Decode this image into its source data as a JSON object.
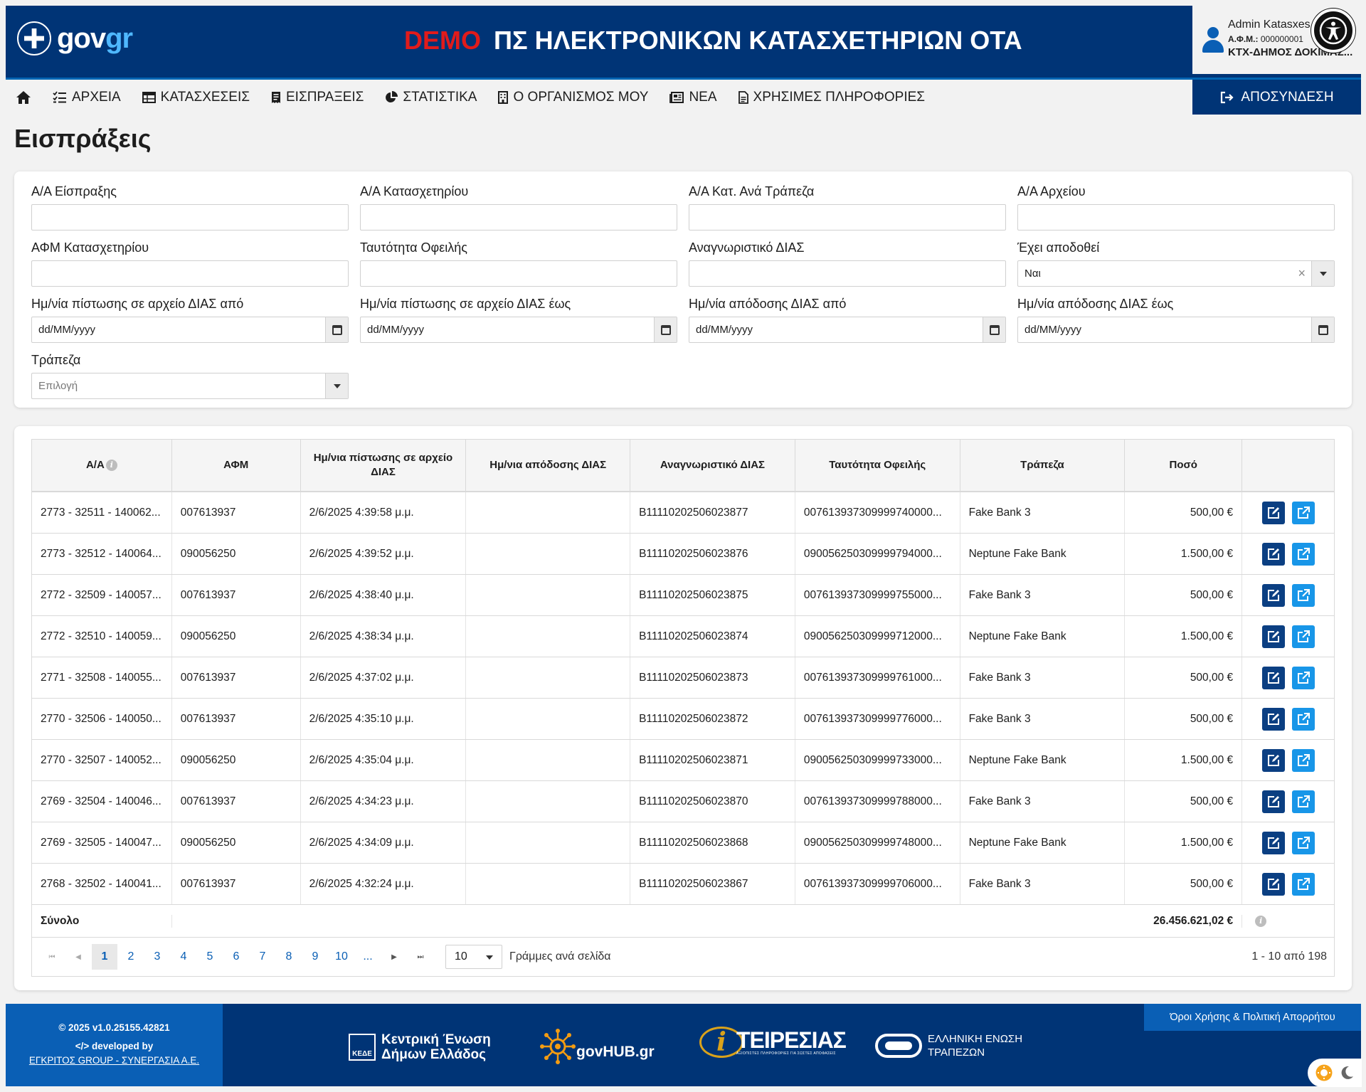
{
  "header": {
    "logo": {
      "part1": "gov",
      "part2": "gr"
    },
    "demo_label": "DEMO",
    "app_title": "ΠΣ ΗΛΕΚΤΡΟΝΙΚΩΝ ΚΑΤΑΣΧΕΤΗΡΙΩΝ ΟΤΑ",
    "user": {
      "name": "Admin Katasxes",
      "afm_label": "Α.Φ.Μ.:",
      "afm_value": "000000001",
      "org": "ΚΤΧ-ΔΗΜΟΣ ΔΟΚΙΜΑΣ..."
    },
    "accessibility_icon": "accessibility-icon"
  },
  "nav": {
    "home_icon": "home-icon",
    "items": [
      {
        "label": "ΑΡΧΕΙΑ",
        "icon": "list-check-icon"
      },
      {
        "label": "ΚΑΤΑΣΧΕΣΕΙΣ",
        "icon": "table-icon"
      },
      {
        "label": "ΕΙΣΠΡΑΞΕΙΣ",
        "icon": "receipt-icon"
      },
      {
        "label": "ΣΤΑΤΙΣΤΙΚΑ",
        "icon": "pie-chart-icon"
      },
      {
        "label": "Ο ΟΡΓΑΝΙΣΜΟΣ ΜΟΥ",
        "icon": "building-icon"
      },
      {
        "label": "ΝΕΑ",
        "icon": "newspaper-icon"
      },
      {
        "label": "ΧΡΗΣΙΜΕΣ ΠΛΗΡΟΦΟΡΙΕΣ",
        "icon": "file-icon"
      }
    ],
    "logout_label": "ΑΠΟΣΥΝΔΕΣΗ"
  },
  "page": {
    "title": "Εισπράξεις"
  },
  "filters": {
    "aa_eispraxis": {
      "label": "Α/Α Είσπραξης",
      "value": ""
    },
    "aa_katasxetiriou": {
      "label": "Α/Α Κατασχετηρίου",
      "value": ""
    },
    "aa_kat_ana_trapeza": {
      "label": "Α/Α Κατ. Ανά Τράπεζα",
      "value": ""
    },
    "aa_arxeiou": {
      "label": "Α/Α Αρχείου",
      "value": ""
    },
    "afm_katasxetiriou": {
      "label": "ΑΦΜ Κατασχετηρίου",
      "value": ""
    },
    "taftotita_ofeilis": {
      "label": "Ταυτότητα Οφειλής",
      "value": ""
    },
    "anagnoristiko_dias": {
      "label": "Αναγνωριστικό ΔΙΑΣ",
      "value": ""
    },
    "exei_apodothei": {
      "label": "Έχει αποδοθεί",
      "value": "Ναι",
      "clear": "×"
    },
    "date_pistosis_apo": {
      "label": "Ημ/νία πίστωσης σε αρχείο ΔΙΑΣ από",
      "value": "dd/MM/yyyy"
    },
    "date_pistosis_eos": {
      "label": "Ημ/νία πίστωσης σε αρχείο ΔΙΑΣ έως",
      "value": "dd/MM/yyyy"
    },
    "date_apodosis_apo": {
      "label": "Ημ/νία απόδοσης ΔΙΑΣ από",
      "value": "dd/MM/yyyy"
    },
    "date_apodosis_eos": {
      "label": "Ημ/νία απόδοσης ΔΙΑΣ έως",
      "value": "dd/MM/yyyy"
    },
    "trapeza": {
      "label": "Τράπεζα",
      "placeholder": "Επιλογή"
    }
  },
  "table": {
    "columns": [
      "Α/Α",
      "ΑΦΜ",
      "Ημ/νια πίστωσης σε αρχείο ΔΙΑΣ",
      "Ημ/νια απόδοσης ΔΙΑΣ",
      "Αναγνωριστικό ΔΙΑΣ",
      "Ταυτότητα Οφειλής",
      "Τράπεζα",
      "Ποσό",
      ""
    ],
    "rows": [
      {
        "aa": "2773 - 32511 - 140062...",
        "afm": "007613937",
        "date_pistosis": "2/6/2025 4:39:58 μ.μ.",
        "date_apodosis": "",
        "dias": "B11110202506023877",
        "ofeili": "007613937309999740000...",
        "bank": "Fake Bank 3",
        "amount": "500,00 €"
      },
      {
        "aa": "2773 - 32512 - 140064...",
        "afm": "090056250",
        "date_pistosis": "2/6/2025 4:39:52 μ.μ.",
        "date_apodosis": "",
        "dias": "B11110202506023876",
        "ofeili": "090056250309999794000...",
        "bank": "Neptune Fake Bank",
        "amount": "1.500,00 €"
      },
      {
        "aa": "2772 - 32509 - 140057...",
        "afm": "007613937",
        "date_pistosis": "2/6/2025 4:38:40 μ.μ.",
        "date_apodosis": "",
        "dias": "B11110202506023875",
        "ofeili": "007613937309999755000...",
        "bank": "Fake Bank 3",
        "amount": "500,00 €"
      },
      {
        "aa": "2772 - 32510 - 140059...",
        "afm": "090056250",
        "date_pistosis": "2/6/2025 4:38:34 μ.μ.",
        "date_apodosis": "",
        "dias": "B11110202506023874",
        "ofeili": "090056250309999712000...",
        "bank": "Neptune Fake Bank",
        "amount": "1.500,00 €"
      },
      {
        "aa": "2771 - 32508 - 140055...",
        "afm": "007613937",
        "date_pistosis": "2/6/2025 4:37:02 μ.μ.",
        "date_apodosis": "",
        "dias": "B11110202506023873",
        "ofeili": "007613937309999761000...",
        "bank": "Fake Bank 3",
        "amount": "500,00 €"
      },
      {
        "aa": "2770 - 32506 - 140050...",
        "afm": "007613937",
        "date_pistosis": "2/6/2025 4:35:10 μ.μ.",
        "date_apodosis": "",
        "dias": "B11110202506023872",
        "ofeili": "007613937309999776000...",
        "bank": "Fake Bank 3",
        "amount": "500,00 €"
      },
      {
        "aa": "2770 - 32507 - 140052...",
        "afm": "090056250",
        "date_pistosis": "2/6/2025 4:35:04 μ.μ.",
        "date_apodosis": "",
        "dias": "B11110202506023871",
        "ofeili": "090056250309999733000...",
        "bank": "Neptune Fake Bank",
        "amount": "1.500,00 €"
      },
      {
        "aa": "2769 - 32504 - 140046...",
        "afm": "007613937",
        "date_pistosis": "2/6/2025 4:34:23 μ.μ.",
        "date_apodosis": "",
        "dias": "B11110202506023870",
        "ofeili": "007613937309999788000...",
        "bank": "Fake Bank 3",
        "amount": "500,00 €"
      },
      {
        "aa": "2769 - 32505 - 140047...",
        "afm": "090056250",
        "date_pistosis": "2/6/2025 4:34:09 μ.μ.",
        "date_apodosis": "",
        "dias": "B11110202506023868",
        "ofeili": "090056250309999748000...",
        "bank": "Neptune Fake Bank",
        "amount": "1.500,00 €"
      },
      {
        "aa": "2768 - 32502 - 140041...",
        "afm": "007613937",
        "date_pistosis": "2/6/2025 4:32:24 μ.μ.",
        "date_apodosis": "",
        "dias": "B11110202506023867",
        "ofeili": "007613937309999706000...",
        "bank": "Fake Bank 3",
        "amount": "500,00 €"
      }
    ],
    "total_label": "Σύνολο",
    "total_amount": "26.456.621,02 €"
  },
  "pagination": {
    "pages": [
      "1",
      "2",
      "3",
      "4",
      "5",
      "6",
      "7",
      "8",
      "9",
      "10",
      "..."
    ],
    "current": "1",
    "page_size": "10",
    "page_size_label": "Γράμμες ανά σελίδα",
    "info": "1 - 10 από 198"
  },
  "footer": {
    "copyright": "2025 v1.0.25155.42821",
    "developed_by": "developed by",
    "developer": "ΕΓΚΡΙΤΟΣ GROUP - ΣΥΝΕΡΓΑΣΙΑ Α.Ε.",
    "terms": "Όροι Χρήσης & Πολιτική Απορρήτου",
    "partners": {
      "kede_line1": "Κεντρική Ένωση",
      "kede_line2": "Δήμων Ελλάδος",
      "kede_mark": "ΚΕΔΕ",
      "govhub": "govHUB.gr",
      "teiresias_mark": "i",
      "teiresias": "ΤΕΙΡΕΣΙΑΣ",
      "teiresias_sub": "ΑΞΙΟΠΙΣΤΕΣ ΠΛΗΡΟΦΟΡΙΕΣ ΓΙΑ ΣΩΣΤΕΣ ΑΠΟΦΑΣΕΙΣ",
      "hba_line1": "ΕΛΛΗΝΙΚΗ ΕΝΩΣΗ",
      "hba_line2": "ΤΡΑΠΕΖΩΝ"
    }
  },
  "theme_toggle": {
    "light_icon": "sun-icon",
    "dark_icon": "moon-icon"
  },
  "colors": {
    "primary": "#003476",
    "accent": "#0a5fb5",
    "demo": "#e11b1b",
    "edit_button": "#0b3f82",
    "open_button": "#1896e8"
  }
}
